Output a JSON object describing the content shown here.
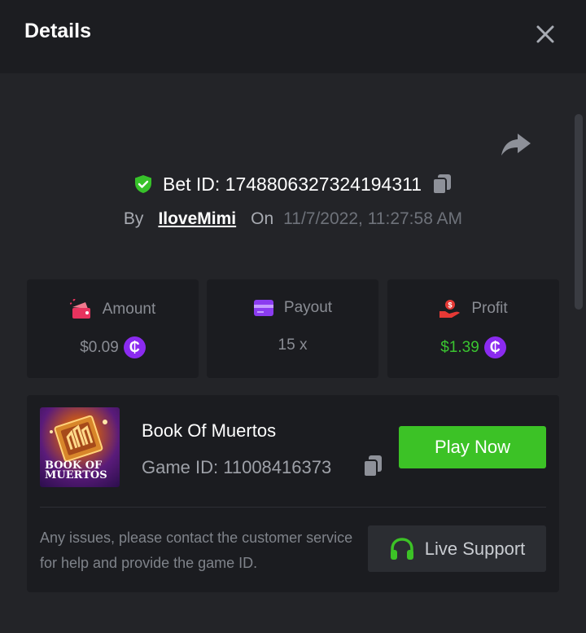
{
  "header": {
    "title": "Details"
  },
  "bet": {
    "id_label": "Bet ID: 1748806327324194311",
    "by_label": "By",
    "username": "IloveMimi",
    "on_label": "On",
    "datetime": "11/7/2022, 11:27:58 AM"
  },
  "stats": {
    "amount": {
      "label": "Amount",
      "value": "$0.09",
      "coin_symbol": "₵"
    },
    "payout": {
      "label": "Payout",
      "value": "15 x"
    },
    "profit": {
      "label": "Profit",
      "value": "$1.39",
      "coin_symbol": "₵"
    }
  },
  "game": {
    "thumb_text_line1": "BOOK OF",
    "thumb_text_line2": "MUERTOS",
    "name": "Book Of Muertos",
    "id_label": "Game ID: 11008416373",
    "play_label": "Play Now"
  },
  "help": {
    "text": "Any issues, please contact the customer service for help and provide the game ID.",
    "support_label": "Live Support"
  },
  "colors": {
    "accent_green": "#3cc226",
    "coin_purple": "#8b2bf0",
    "profit_green": "#3ac430",
    "amount_icon": "#e8335e",
    "payout_icon": "#8b3cf0",
    "profit_icon": "#e53935"
  },
  "icons": {
    "close": "close-icon",
    "share": "share-icon",
    "shield": "shield-check-icon",
    "copy": "copy-icon",
    "amount": "wallet-coins-icon",
    "payout": "card-icon",
    "profit": "hand-money-icon",
    "support": "headset-icon"
  }
}
